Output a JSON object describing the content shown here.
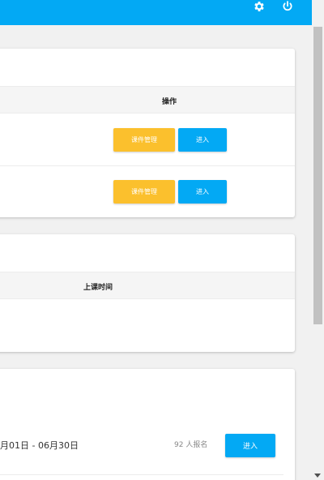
{
  "header": {
    "settings_icon": "gear-icon",
    "power_icon": "power-icon"
  },
  "courses_table": {
    "column_action": "操作",
    "rows": [
      {
        "manage_label": "课件管理",
        "enter_label": "进入"
      },
      {
        "manage_label": "课件管理",
        "enter_label": "进入"
      }
    ]
  },
  "schedule_table": {
    "column_time": "上课时间"
  },
  "enrollment": {
    "date_range": "月01日 - 06月30日",
    "enrolled": "92 人报名",
    "enter_label": "进入"
  },
  "colors": {
    "primary": "#03a9f4",
    "warning": "#fbc02d"
  }
}
